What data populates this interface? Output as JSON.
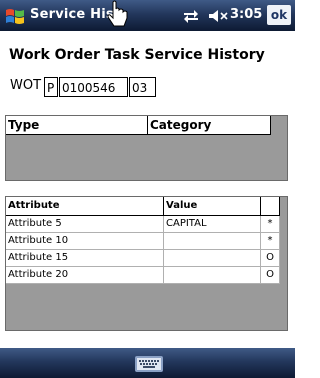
{
  "titlebar": {
    "app_title": "Service History",
    "clock": "3:05",
    "ok_label": "ok",
    "icons": [
      "windows-start-icon",
      "stylus-cursor-icon",
      "connectivity-icon",
      "volume-icon"
    ]
  },
  "page": {
    "title": "Work Order Task Service History"
  },
  "wot": {
    "label": "WOT",
    "type_value": "P",
    "number_value": "0100546",
    "suffix_value": "03"
  },
  "type_grid": {
    "headers": [
      "Type",
      "Category"
    ]
  },
  "attr_grid": {
    "headers": [
      "Attribute",
      "Value",
      ""
    ],
    "rows": [
      {
        "attribute": "Attribute 5",
        "value": "CAPITAL",
        "flag": "*"
      },
      {
        "attribute": "Attribute 10",
        "value": "",
        "flag": "*"
      },
      {
        "attribute": "Attribute 15",
        "value": "",
        "flag": "O"
      },
      {
        "attribute": "Attribute 20",
        "value": "",
        "flag": "O"
      }
    ]
  },
  "bottombar": {
    "sip_icon": "keyboard-icon"
  },
  "colors": {
    "bar_top": "#3f5a86",
    "bar_bottom": "#0d1a33",
    "grid_background": "#9a9a9a"
  }
}
